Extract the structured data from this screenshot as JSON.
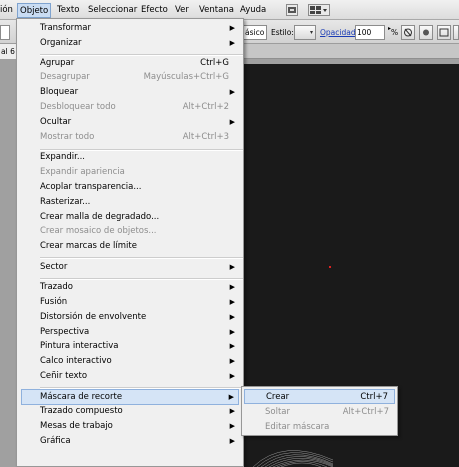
{
  "menubar": {
    "items": [
      "ión",
      "Objeto",
      "Texto",
      "Seleccionar",
      "Efecto",
      "Ver",
      "Ventana",
      "Ayuda"
    ],
    "active": "Objeto"
  },
  "controlbar": {
    "left_value": "",
    "basico_partial": "ásico",
    "estilo_label": "Estilo:",
    "opacidad_label": "Opacidad:",
    "opacidad_value": "100",
    "percent": "%"
  },
  "doctab": {
    "label": "al 6"
  },
  "menu": {
    "transformar": "Transformar",
    "organizar": "Organizar",
    "agrupar": "Agrupar",
    "agrupar_sc": "Ctrl+G",
    "desagrupar": "Desagrupar",
    "desagrupar_sc": "Mayúsculas+Ctrl+G",
    "bloquear": "Bloquear",
    "desbloquear": "Desbloquear todo",
    "desbloquear_sc": "Alt+Ctrl+2",
    "ocultar": "Ocultar",
    "mostrar": "Mostrar todo",
    "mostrar_sc": "Alt+Ctrl+3",
    "expandir": "Expandir...",
    "expandir_apariencia": "Expandir apariencia",
    "acoplar": "Acoplar transparencia...",
    "rasterizar": "Rasterizar...",
    "malla": "Crear malla de degradado...",
    "mosaico": "Crear mosaico de objetos...",
    "marcas": "Crear marcas de límite",
    "sector": "Sector",
    "trazado": "Trazado",
    "fusion": "Fusión",
    "distorsion": "Distorsión de envolvente",
    "perspectiva": "Perspectiva",
    "pintura": "Pintura interactiva",
    "calco": "Calco interactivo",
    "cenir": "Ceñir texto",
    "mascara": "Máscara de recorte",
    "trazado_compuesto": "Trazado compuesto",
    "mesas": "Mesas de trabajo",
    "grafica": "Gráfica"
  },
  "submenu": {
    "crear": "Crear",
    "crear_sc": "Ctrl+7",
    "soltar": "Soltar",
    "soltar_sc": "Alt+Ctrl+7",
    "editar": "Editar máscara"
  },
  "colors": {
    "highlight": "#d5e4f6",
    "artboard": "#1a1a1a",
    "link": "#1a3bb5"
  },
  "icons": [
    "bridge-icon",
    "arrange-documents-icon",
    "chevron-down-icon",
    "submenu-arrow-icon",
    "recolor-icon",
    "align-icon",
    "transform-icon",
    "isolate-icon",
    "menu-options-icon"
  ]
}
